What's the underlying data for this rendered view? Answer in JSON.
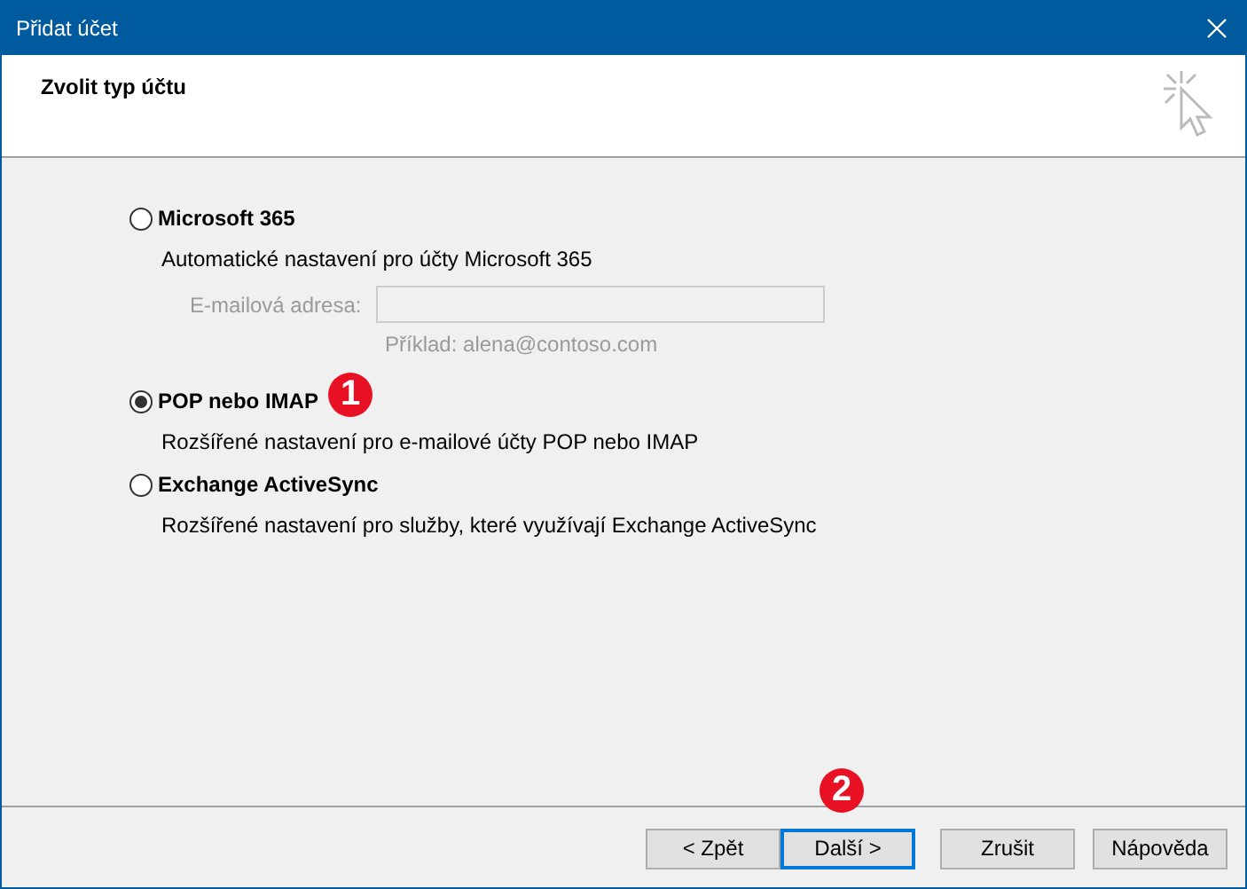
{
  "window": {
    "title": "Přidat účet"
  },
  "header": {
    "title": "Zvolit typ účtu"
  },
  "options": [
    {
      "label": "Microsoft 365",
      "selected": false,
      "description": "Automatické nastavení pro účty Microsoft 365",
      "email": {
        "label": "E-mailová adresa:",
        "disabled": true,
        "hint": "Příklad: alena@contoso.com"
      }
    },
    {
      "label": "POP nebo IMAP",
      "selected": true,
      "description": "Rozšířené nastavení pro e-mailové účty POP nebo IMAP",
      "callout": "1"
    },
    {
      "label": "Exchange ActiveSync",
      "selected": false,
      "description": "Rozšířené nastavení pro služby, které využívají Exchange ActiveSync"
    }
  ],
  "buttons": [
    {
      "label": "< Zpět",
      "default": false
    },
    {
      "label": "Další >",
      "default": true,
      "callout": "2"
    },
    {
      "label": "Zrušit",
      "default": false
    },
    {
      "label": "Nápověda",
      "default": false
    }
  ]
}
